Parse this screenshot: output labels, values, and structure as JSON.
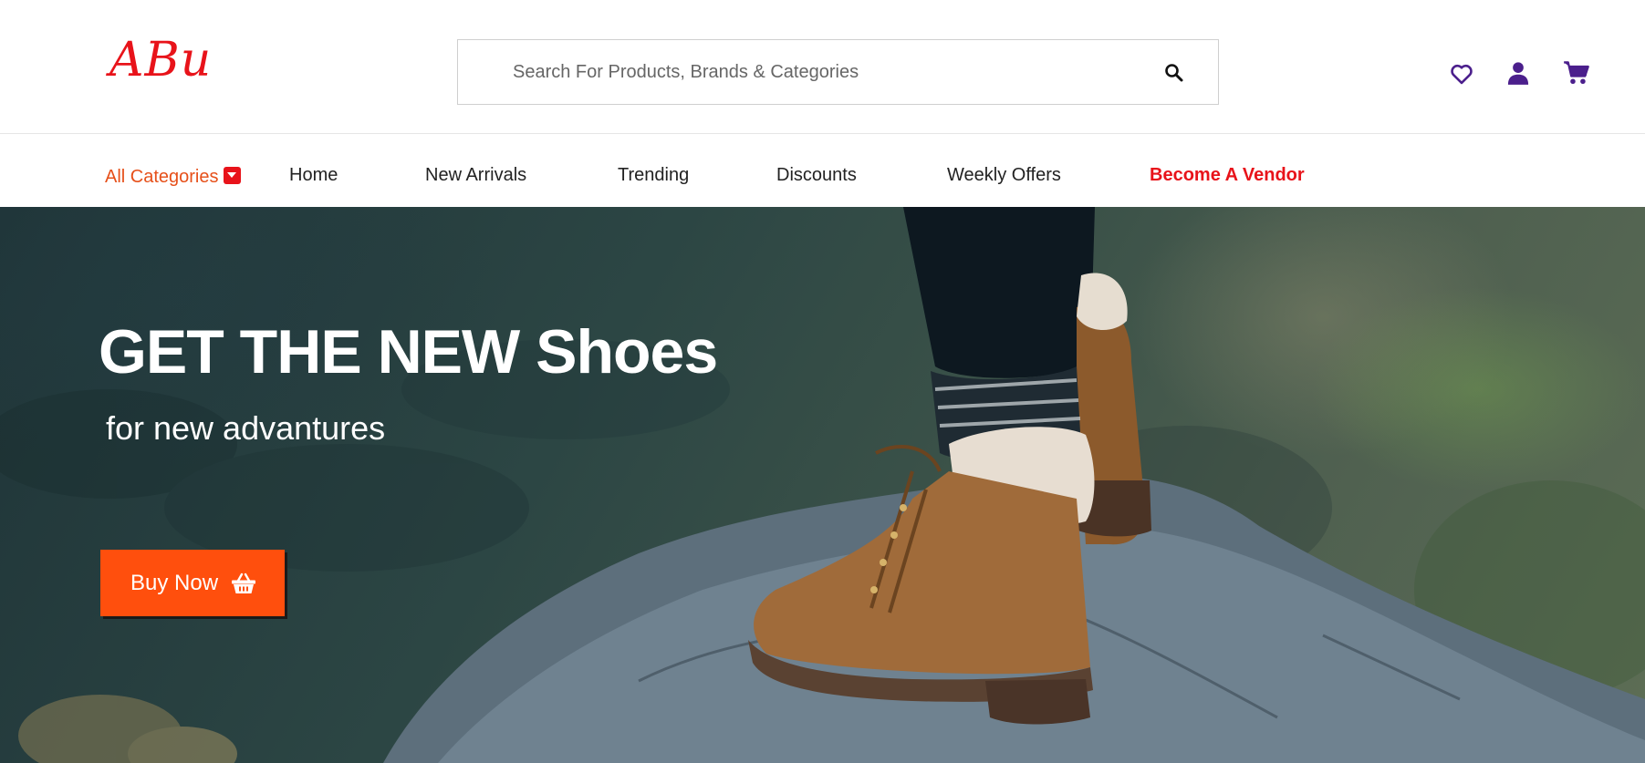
{
  "header": {
    "logo_text": "ABu",
    "search": {
      "placeholder": "Search For Products, Brands & Categories",
      "value": ""
    },
    "icons": [
      "heart-icon",
      "user-icon",
      "cart-icon",
      "search-icon"
    ]
  },
  "nav": {
    "all_categories": "All Categories",
    "items": [
      {
        "label": "Home"
      },
      {
        "label": "New Arrivals"
      },
      {
        "label": "Trending"
      },
      {
        "label": "Discounts"
      },
      {
        "label": "Weekly Offers"
      },
      {
        "label": "Become A Vendor"
      }
    ]
  },
  "hero": {
    "title": "GET THE NEW Shoes",
    "subtitle": "for new advantures",
    "cta_label": "Buy Now"
  },
  "colors": {
    "brand_red": "#e8131a",
    "accent_orange": "#ff4f0d",
    "icon_purple": "#4b1f8c",
    "categories_orange": "#e6501a"
  }
}
